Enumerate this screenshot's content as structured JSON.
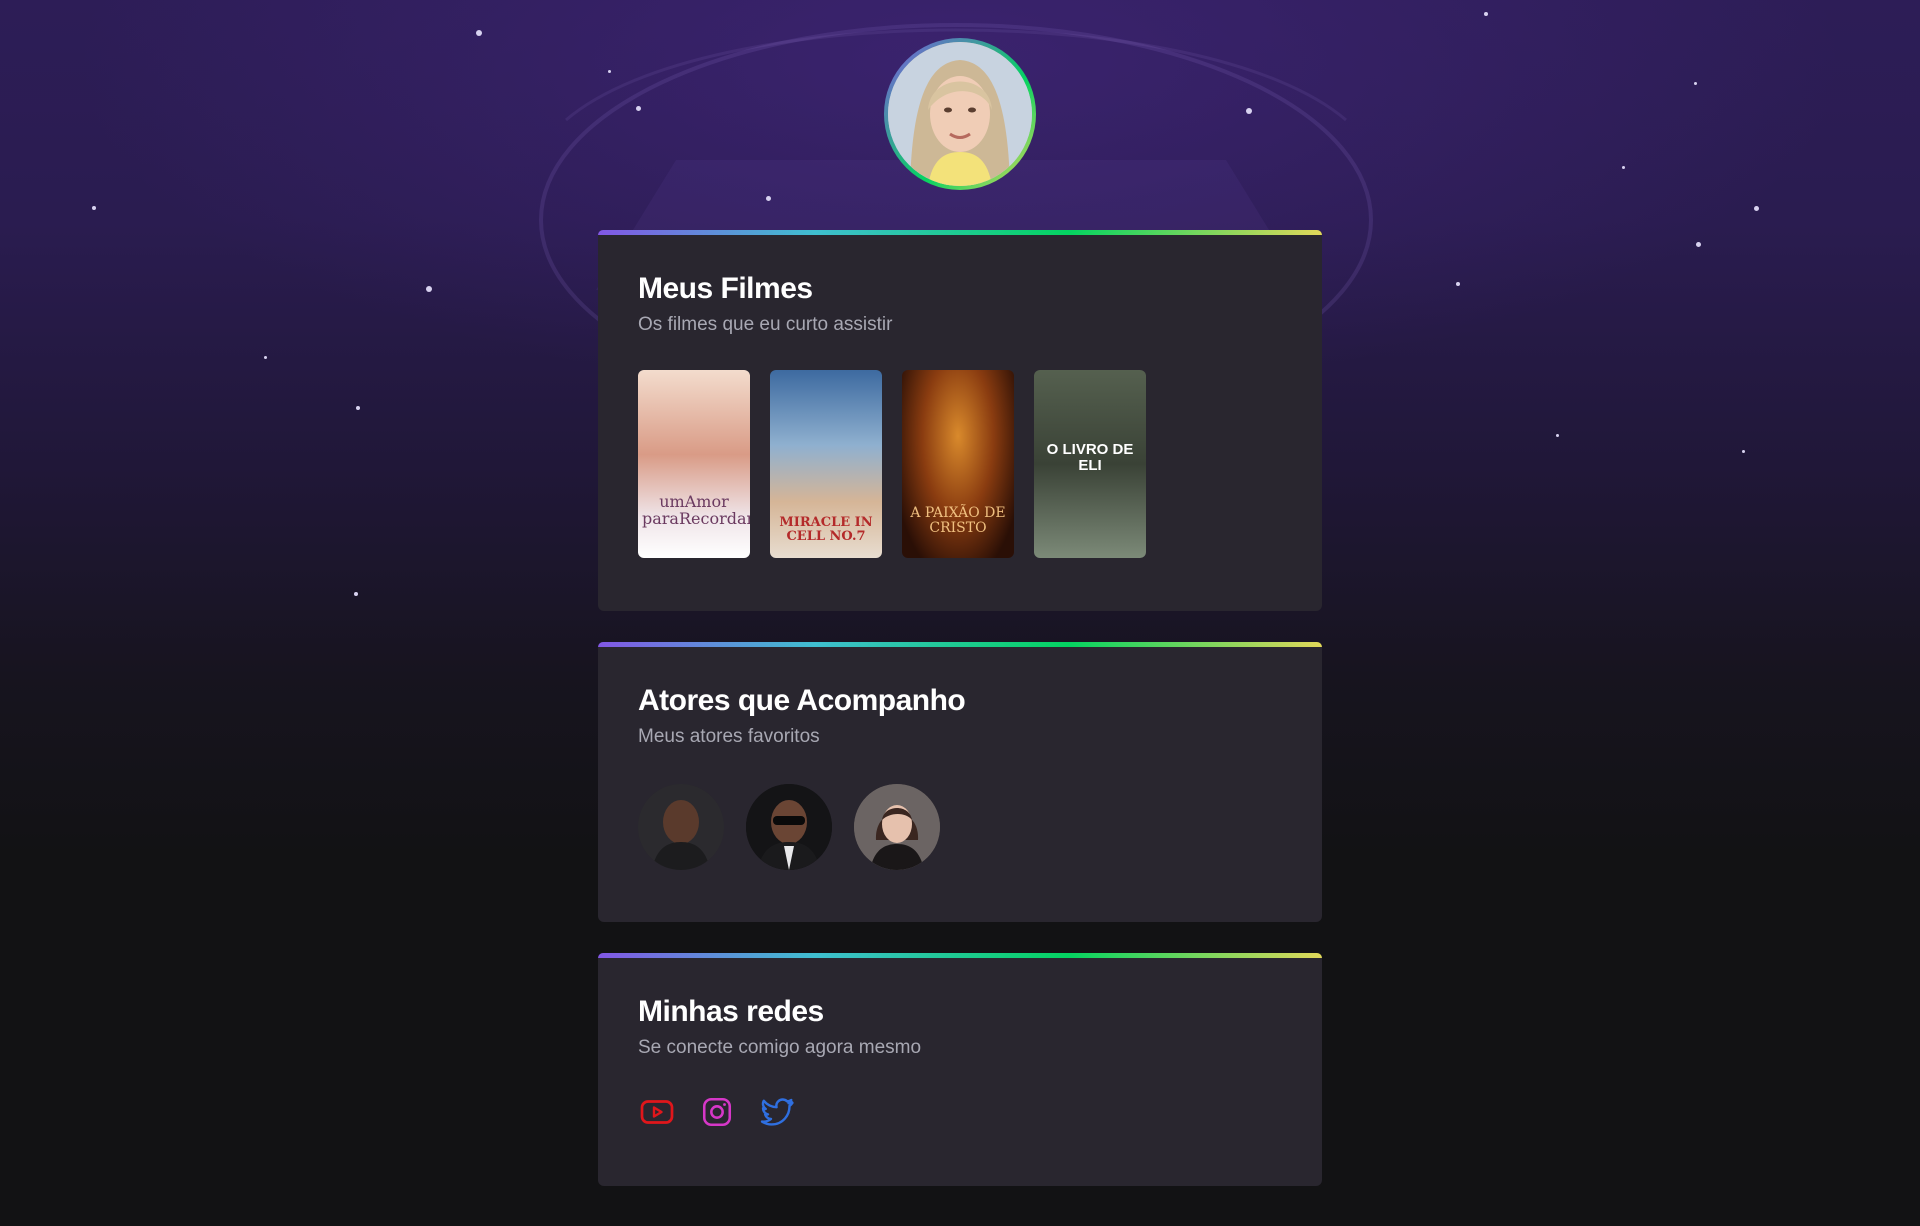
{
  "profile": {
    "avatar_alt": "profile photo"
  },
  "movies": {
    "title": "Meus Filmes",
    "subtitle": "Os filmes que eu curto assistir",
    "items": [
      {
        "poster_text": "umAmor paraRecordar",
        "color": "#e9c9b8"
      },
      {
        "poster_text": "MIRACLE IN CELL NO.7",
        "color": "#6f8fb5"
      },
      {
        "poster_text": "A PAIXÃO DE CRISTO",
        "color": "#7a3a10"
      },
      {
        "poster_text": "O LIVRO DE ELI",
        "color": "#4a5048"
      }
    ]
  },
  "actors": {
    "title": "Atores que Acompanho",
    "subtitle": "Meus atores favoritos",
    "items": [
      {
        "icon": "actor-avatar-1",
        "color": "#3a2a24"
      },
      {
        "icon": "actor-avatar-2",
        "color": "#1a1a1c"
      },
      {
        "icon": "actor-avatar-3",
        "color": "#4a4240"
      }
    ]
  },
  "socials": {
    "title": "Minhas redes",
    "subtitle": "Se conecte comigo agora mesmo",
    "items": [
      {
        "icon": "youtube-icon",
        "color": "#e0161b"
      },
      {
        "icon": "instagram-icon",
        "color": "#d637c8"
      },
      {
        "icon": "twitter-icon",
        "color": "#2f6fe0"
      }
    ]
  }
}
